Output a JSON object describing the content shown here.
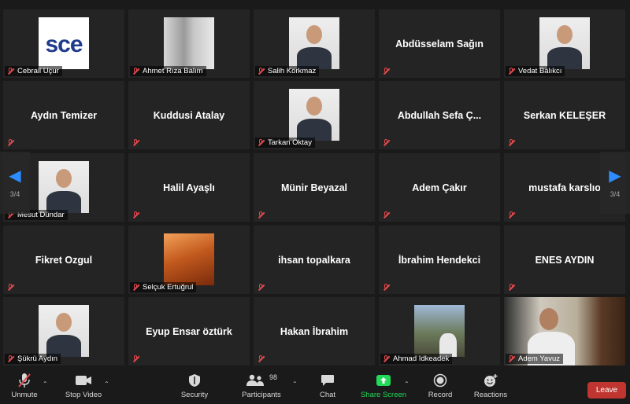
{
  "tiles": [
    {
      "name": "Cebrail Uçur",
      "display": "",
      "kind": "logo",
      "logo_text": "sce"
    },
    {
      "name": "Ahmet Rıza Balım",
      "display": "",
      "kind": "blur"
    },
    {
      "name": "Salih Korkmaz",
      "display": "",
      "kind": "photo"
    },
    {
      "name": "",
      "display": "Abdüsselam Sağın",
      "kind": "text"
    },
    {
      "name": "Vedat Balıkcı",
      "display": "",
      "kind": "photo"
    },
    {
      "name": "",
      "display": "Aydın Temizer",
      "kind": "text"
    },
    {
      "name": "",
      "display": "Kuddusi Atalay",
      "kind": "text"
    },
    {
      "name": "Tarkan Oktay",
      "display": "",
      "kind": "photo"
    },
    {
      "name": "",
      "display": "Abdullah Sefa Ç...",
      "kind": "text"
    },
    {
      "name": "",
      "display": "Serkan KELEŞER",
      "kind": "text"
    },
    {
      "name": "Mesut Dündar",
      "display": "",
      "kind": "photo"
    },
    {
      "name": "",
      "display": "Halil Ayaşlı",
      "kind": "text"
    },
    {
      "name": "",
      "display": "Münir Beyazal",
      "kind": "text"
    },
    {
      "name": "",
      "display": "Adem Çakır",
      "kind": "text"
    },
    {
      "name": "",
      "display": "mustafa karslıo",
      "kind": "text"
    },
    {
      "name": "",
      "display": "Fikret Ozgul",
      "kind": "text"
    },
    {
      "name": "Selçuk Ertuğrul",
      "display": "",
      "kind": "sunset"
    },
    {
      "name": "",
      "display": "ihsan topalkara",
      "kind": "text"
    },
    {
      "name": "",
      "display": "İbrahim Hendekci",
      "kind": "text"
    },
    {
      "name": "",
      "display": "ENES AYDIN",
      "kind": "text"
    },
    {
      "name": "Şükrü Aydın",
      "display": "",
      "kind": "photo"
    },
    {
      "name": "",
      "display": "Eyup Ensar öztürk",
      "kind": "text"
    },
    {
      "name": "",
      "display": "Hakan İbrahim",
      "kind": "text"
    },
    {
      "name": "Ahmad Idkeadek",
      "display": "",
      "kind": "outdoor"
    },
    {
      "name": "Adem Yavuz",
      "display": "",
      "kind": "live"
    }
  ],
  "pager": {
    "left": "3/4",
    "right": "3/4"
  },
  "toolbar": {
    "unmute": "Unmute",
    "stop_video": "Stop Video",
    "security": "Security",
    "participants": "Participants",
    "participants_count": "98",
    "chat": "Chat",
    "share_screen": "Share Screen",
    "record": "Record",
    "reactions": "Reactions",
    "leave": "Leave"
  },
  "colors": {
    "accent": "#2d8cff",
    "share": "#23d959",
    "leave": "#c0352f",
    "muted": "#e5484d"
  }
}
